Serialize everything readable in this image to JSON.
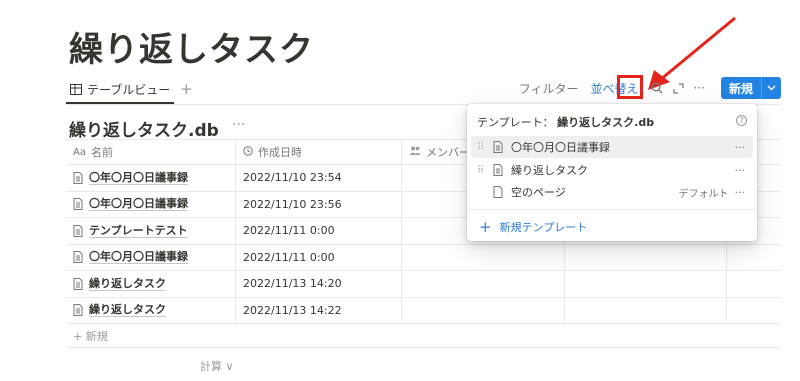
{
  "page": {
    "title": "繰り返しタスク"
  },
  "viewbar": {
    "tab_label": "テーブルビュー",
    "add_view": "+",
    "filter_label": "フィルター",
    "sort_label": "並べ替え",
    "more": "···",
    "new_label": "新規"
  },
  "database": {
    "title": "繰り返しタスク.db",
    "more": "···"
  },
  "table": {
    "columns": [
      {
        "icon": "Aa",
        "label": "名前"
      },
      {
        "icon": "clock-icon",
        "label": "作成日時"
      },
      {
        "icon": "people-icon",
        "label": "メンバー"
      },
      {
        "icon": "",
        "label": ""
      },
      {
        "icon": "",
        "label": ""
      }
    ],
    "rows": [
      {
        "name": "〇年〇月〇日議事録",
        "created": "2022/11/10 23:54"
      },
      {
        "name": "〇年〇月〇日議事録",
        "created": "2022/11/10 23:56"
      },
      {
        "name": "テンプレートテスト",
        "created": "2022/11/11 0:00"
      },
      {
        "name": "〇年〇月〇日議事録",
        "created": "2022/11/11 0:00"
      },
      {
        "name": "繰り返しタスク",
        "created": "2022/11/13 14:20"
      },
      {
        "name": "繰り返しタスク",
        "created": "2022/11/13 14:22"
      }
    ],
    "add_row": "+ 新規",
    "calc_label": "計算 ∨"
  },
  "popup": {
    "header_prefix": "テンプレート：",
    "header_db": "繰り返しタスク.db",
    "items": [
      {
        "label": "〇年〇月〇日議事録",
        "tag": "",
        "more": "···"
      },
      {
        "label": "繰り返しタスク",
        "tag": "",
        "more": "···"
      },
      {
        "label": "空のページ",
        "tag": "デフォルト",
        "more": "···"
      }
    ],
    "new_template": "新規テンプレート"
  },
  "colors": {
    "accent": "#2383e2",
    "highlight": "#e5231b",
    "text": "#37352f",
    "muted": "#787774"
  }
}
